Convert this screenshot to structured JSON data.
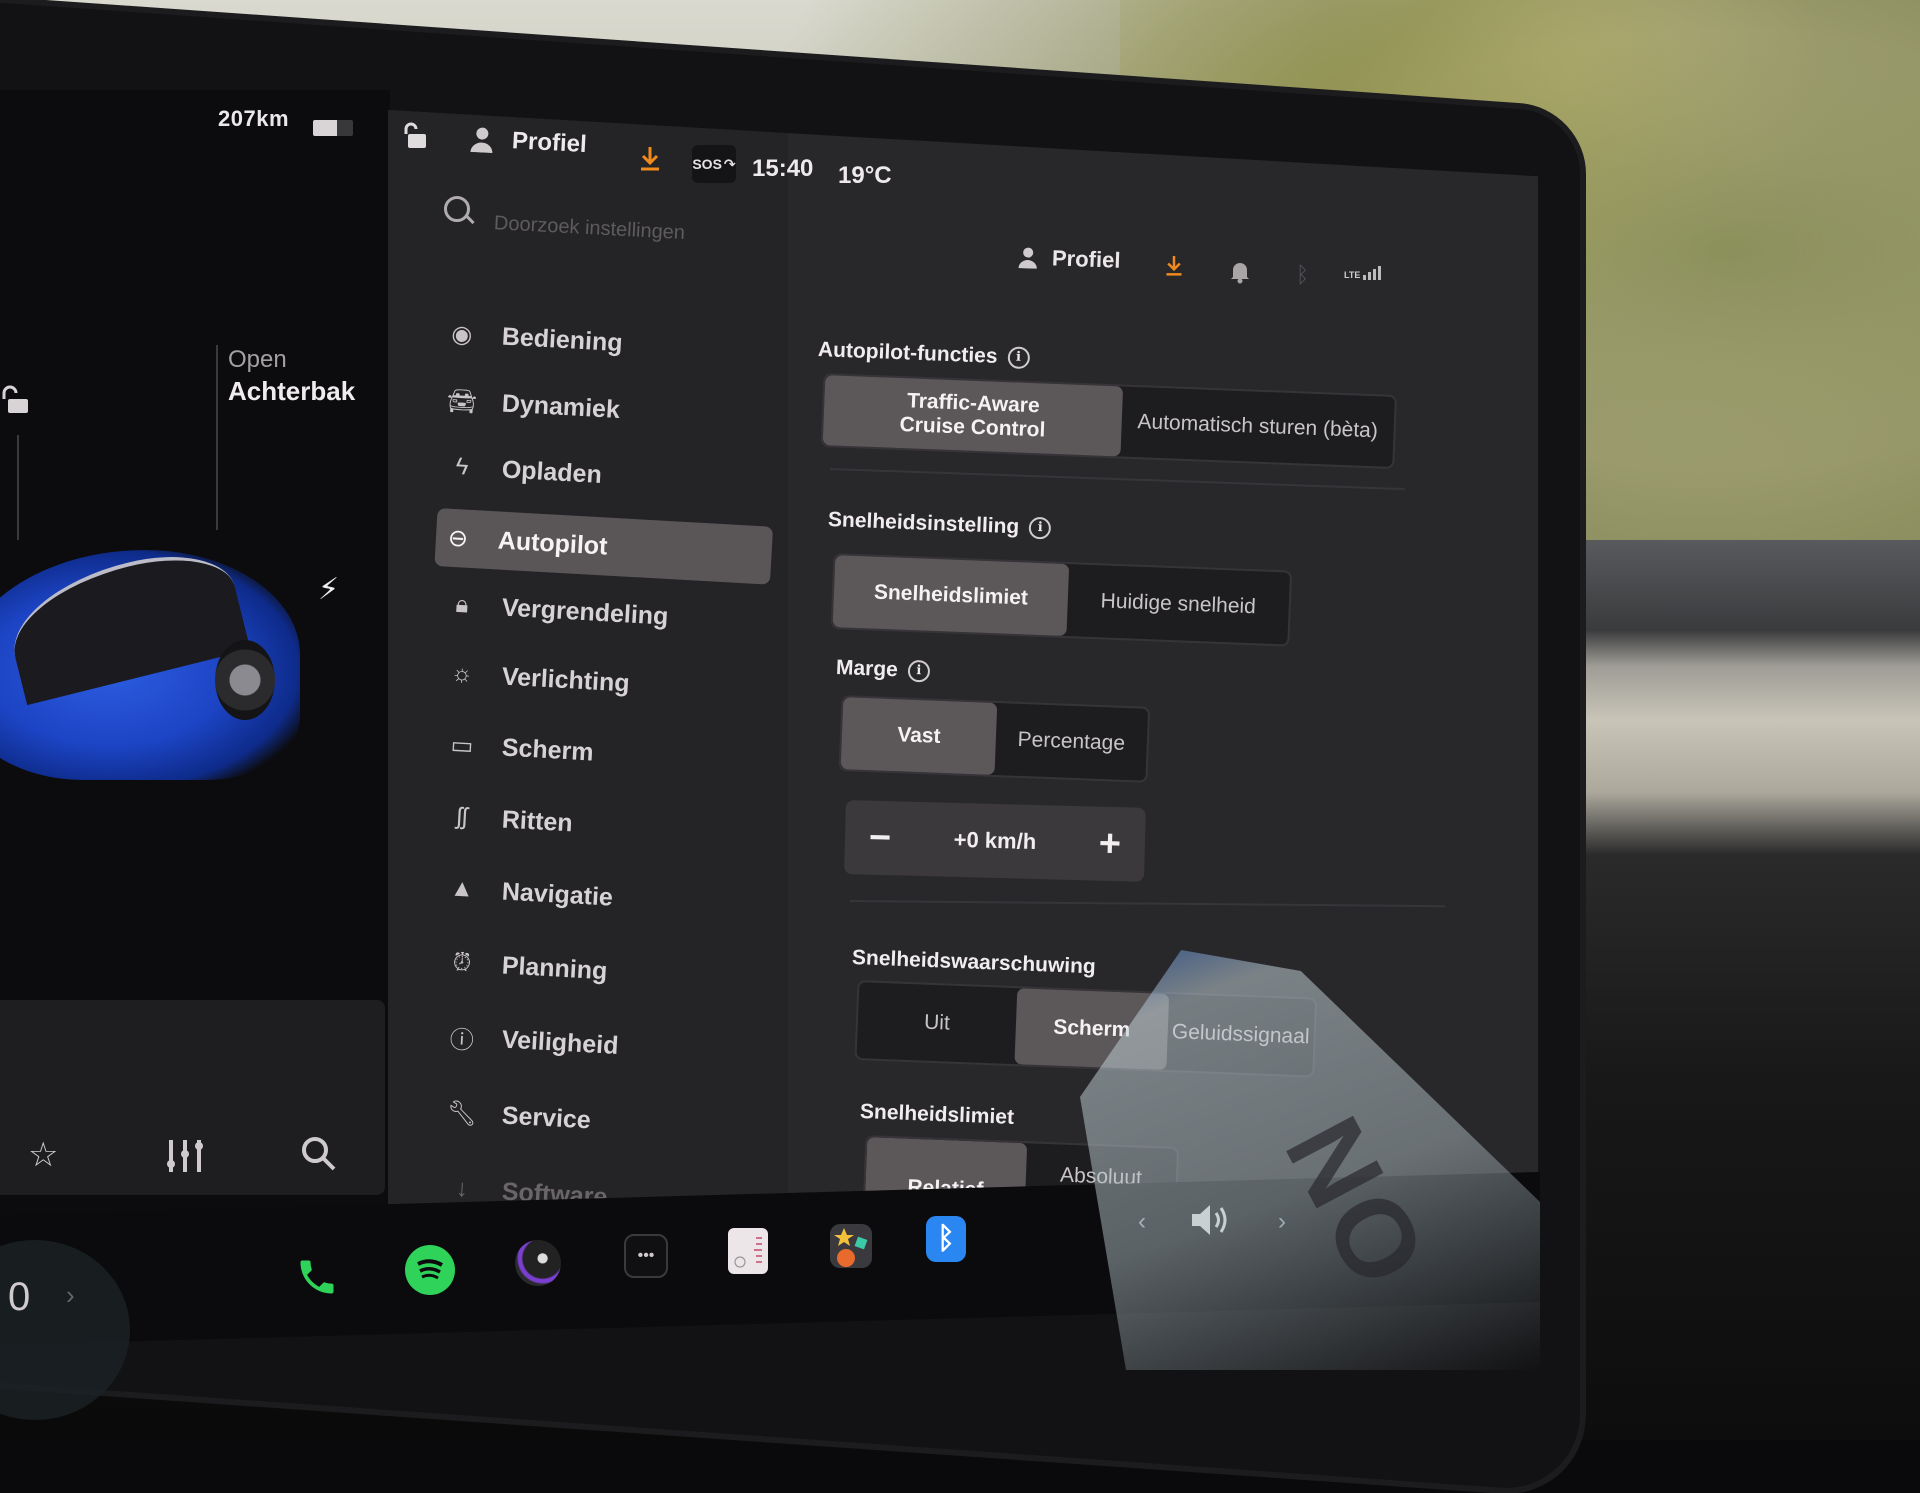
{
  "status_bar": {
    "range": "207km",
    "battery_level_percent": 60,
    "lock_icon": "lock-open-icon",
    "profile_label": "Profiel",
    "download_icon": "download-icon",
    "sos_label": "SOS",
    "time": "15:40",
    "temperature": "19°C"
  },
  "car_panel": {
    "trunk_line1": "Open",
    "trunk_line2": "Achterbak",
    "charge_icon": "lightning-icon",
    "media_buttons": [
      "star-icon",
      "equalizer-icon",
      "search-icon"
    ],
    "odometer_partial": "0",
    "chevron": "›"
  },
  "settings": {
    "search_placeholder": "Doorzoek instellingen",
    "header": {
      "profile_label": "Profiel",
      "icons": [
        "download-icon",
        "bell-icon",
        "bluetooth-icon",
        "lte-signal-icon"
      ],
      "lte_label": "LTE"
    },
    "sidebar": {
      "items": [
        {
          "label": "Bediening",
          "icon": "toggle-icon",
          "active": false
        },
        {
          "label": "Dynamiek",
          "icon": "car-icon",
          "active": false
        },
        {
          "label": "Opladen",
          "icon": "lightning-icon",
          "active": false
        },
        {
          "label": "Autopilot",
          "icon": "steering-wheel-icon",
          "active": true
        },
        {
          "label": "Vergrendeling",
          "icon": "lock-icon",
          "active": false
        },
        {
          "label": "Verlichting",
          "icon": "sun-icon",
          "active": false
        },
        {
          "label": "Scherm",
          "icon": "display-icon",
          "active": false
        },
        {
          "label": "Ritten",
          "icon": "route-icon",
          "active": false
        },
        {
          "label": "Navigatie",
          "icon": "navigation-arrow-icon",
          "active": false
        },
        {
          "label": "Planning",
          "icon": "alarm-clock-icon",
          "active": false
        },
        {
          "label": "Veiligheid",
          "icon": "alert-circle-icon",
          "active": false
        },
        {
          "label": "Service",
          "icon": "wrench-icon",
          "active": false
        },
        {
          "label": "Software",
          "icon": "download-icon",
          "active": false
        }
      ]
    },
    "content": {
      "autopilot_features": {
        "title": "Autopilot-functies",
        "options": [
          "Traffic-Aware\nCruise Control",
          "Automatisch sturen (bèta)"
        ],
        "selected": "Traffic-Aware Cruise Control"
      },
      "speed_setting": {
        "title": "Snelheidsinstelling",
        "options": [
          "Snelheidslimiet",
          "Huidige snelheid"
        ],
        "selected": "Snelheidslimiet"
      },
      "margin": {
        "title": "Marge",
        "options": [
          "Vast",
          "Percentage"
        ],
        "selected": "Vast",
        "stepper_value": "+0 km/h",
        "minus_label": "−",
        "plus_label": "+"
      },
      "speed_warning": {
        "title": "Snelheidswaarschuwing",
        "options": [
          "Uit",
          "Scherm",
          "Geluidssignaal"
        ],
        "selected": "Scherm"
      },
      "speed_limit": {
        "title": "Snelheidslimiet",
        "options": [
          "Relatief",
          "Absoluut"
        ],
        "selected": "Relatief"
      }
    }
  },
  "dock": {
    "apps": [
      {
        "name": "phone",
        "icon": "phone-icon",
        "color": "#2fd35a"
      },
      {
        "name": "spotify",
        "icon": "spotify-icon",
        "color": "#2fd35a"
      },
      {
        "name": "camera",
        "icon": "camera-icon",
        "color": "#7a3fd0"
      },
      {
        "name": "more",
        "icon": "more-dots-icon",
        "label": "•••"
      },
      {
        "name": "calendar",
        "icon": "calendar-icon",
        "color": "#e9e3e6"
      },
      {
        "name": "toybox",
        "icon": "toybox-icon",
        "color": "#f0a030"
      },
      {
        "name": "bluetooth",
        "icon": "bluetooth-icon",
        "color": "#2a86f0"
      }
    ],
    "volume_icon": "volume-icon",
    "volume_prev": "‹",
    "volume_next": "›"
  },
  "colors": {
    "accent_orange": "#f08a1c",
    "selected_segment": "#5c5759",
    "panel_bg": "#28272a",
    "car_blue": "#1c44c4"
  }
}
